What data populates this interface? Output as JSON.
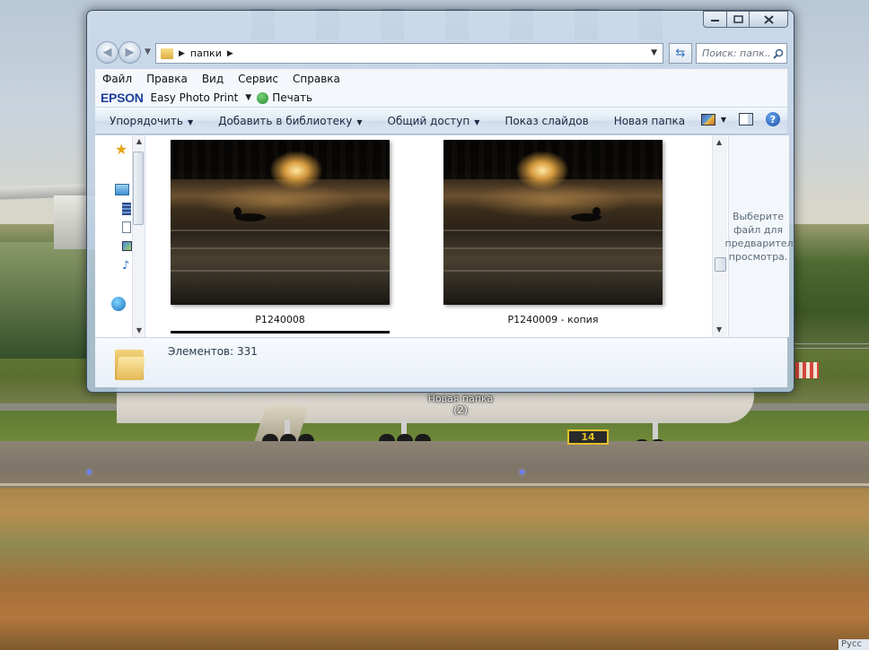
{
  "window": {
    "address": {
      "folder": "папки"
    },
    "search": {
      "placeholder": "Поиск: папк..."
    },
    "menu": [
      "Файл",
      "Правка",
      "Вид",
      "Сервис",
      "Справка"
    ],
    "epson": {
      "logo": "EPSON",
      "app": "Easy Photo Print",
      "print": "Печать"
    },
    "commands": {
      "organize": "Упорядочить",
      "add_library": "Добавить в библиотеку",
      "share": "Общий доступ",
      "slideshow": "Показ слайдов",
      "new_folder": "Новая папка"
    },
    "files": [
      {
        "name": "P1240008"
      },
      {
        "name": "P1240009 - копия"
      }
    ],
    "preview_text": "Выберите\nфайл для\nпредварительного\nпросмотра.",
    "details": {
      "count": "Элементов: 331"
    }
  },
  "desktop": {
    "folder_name": "Новая папка",
    "folder_count": "(2)",
    "runway_sign": "14",
    "lang": "Русс"
  },
  "colors": {
    "command_bar": "#dde7f3",
    "epson_blue": "#1d3f9a",
    "preview_text": "#5c6b7c"
  }
}
